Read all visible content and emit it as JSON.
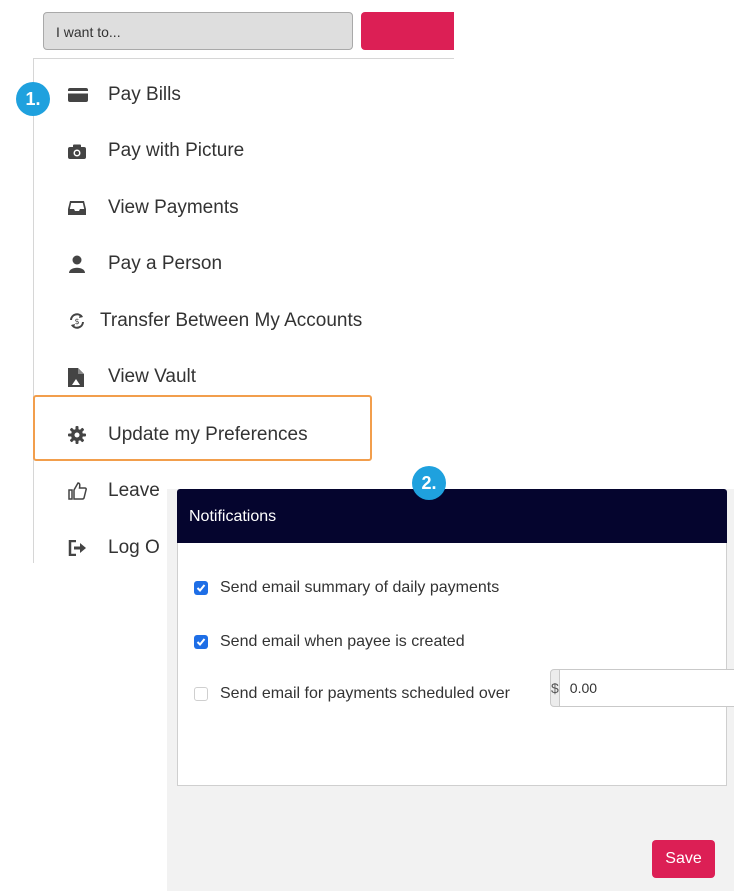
{
  "top_bar": {
    "dropdown_text": "I want to...",
    "accent_color": "#dc1f55"
  },
  "badges": {
    "step1": "1.",
    "step2": "2.",
    "color": "#1fa1de"
  },
  "menu": {
    "items": [
      {
        "label": "Pay Bills",
        "icon": "credit-card-icon"
      },
      {
        "label": "Pay with Picture",
        "icon": "camera-icon"
      },
      {
        "label": "View Payments",
        "icon": "inbox-icon"
      },
      {
        "label": "Pay a Person",
        "icon": "user-icon"
      },
      {
        "label": "Transfer Between My Accounts",
        "icon": "transfer-icon"
      },
      {
        "label": "View Vault",
        "icon": "vault-file-icon"
      },
      {
        "label": "Update my Preferences",
        "icon": "gear-icon"
      },
      {
        "label": "Leave",
        "icon": "thumbs-up-icon"
      },
      {
        "label": "Log O",
        "icon": "logout-icon"
      }
    ],
    "highlight_color": "#f29e4c"
  },
  "notifications": {
    "title": "Notifications",
    "header_color": "#05052e",
    "options": [
      {
        "label": "Send email summary of daily payments",
        "checked": true
      },
      {
        "label": "Send email when payee is created",
        "checked": true
      },
      {
        "label": "Send email for payments scheduled over",
        "checked": false
      }
    ],
    "currency_symbol": "$",
    "amount_value": "0.00",
    "save_label": "Save"
  }
}
